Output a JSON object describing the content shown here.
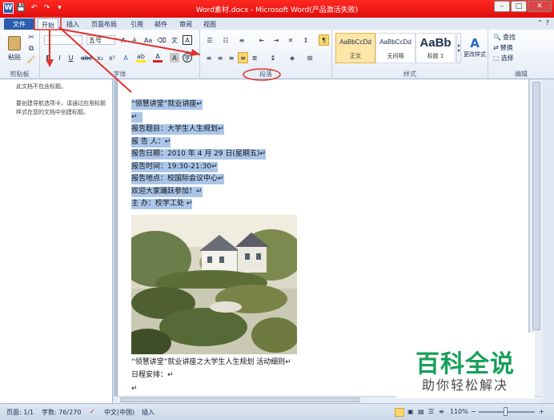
{
  "window": {
    "title": "Word素材.docx - Microsoft Word(产品激活失败)"
  },
  "quick_access": [
    "W",
    "💾",
    "↶",
    "↷",
    "▾"
  ],
  "window_controls": [
    "–",
    "□",
    "✕"
  ],
  "tabs": [
    "文件",
    "开始",
    "插入",
    "页面布局",
    "引用",
    "邮件",
    "审阅",
    "视图"
  ],
  "ribbon": {
    "clipboard": {
      "paste_label": "粘贴",
      "group_label": "剪贴板"
    },
    "font": {
      "font_size": "五号",
      "group_label": "字体"
    },
    "paragraph": {
      "group_label": "段落"
    },
    "styles": {
      "items": [
        {
          "sample": "AaBbCcDd",
          "name": "正文"
        },
        {
          "sample": "AaBbCcDd",
          "name": "无间隔"
        },
        {
          "sample": "AaBb",
          "name": "标题 1"
        }
      ],
      "change_styles_label": "更改样式",
      "group_label": "样式"
    },
    "editing": {
      "find": "查找",
      "replace": "替换",
      "select": "选择",
      "group_label": "编辑"
    }
  },
  "nav_pane": {
    "no_headings": "此文档不包含标题。",
    "hint": "要创建导航选项卡，请通过应用标题样式在您的文档中创建标题。"
  },
  "document": {
    "lines": [
      "“领慧讲堂”就业讲座↵",
      "↵",
      "报告题目：大学生人生规划↵",
      "报  告  人：↵",
      "报告日期：2010 年 4 月 29 日(星期五)↵",
      "报告时间：19:30-21:30↵",
      "报告地点：校国际会议中心↵",
      "欢迎大家踊跃参加！↵",
      "主  办：校学工处  ↵"
    ],
    "after_image": [
      "“领慧讲堂”就业讲座之大学生人生规划  活动细则↵",
      "日程安排：↵",
      "↵"
    ]
  },
  "status_bar": {
    "page": "页面: 1/1",
    "words": "字数: 76/270",
    "language": "中文(中国)",
    "mode": "插入",
    "zoom": "110%"
  },
  "watermark": {
    "main": "百科全说",
    "sub": "助你轻松解决"
  },
  "colors": {
    "title_bar": "#e61512",
    "file_tab": "#2a5dad",
    "selection": "#aac6ea",
    "annotation": "#e0312b",
    "watermark": "#17a05a"
  }
}
